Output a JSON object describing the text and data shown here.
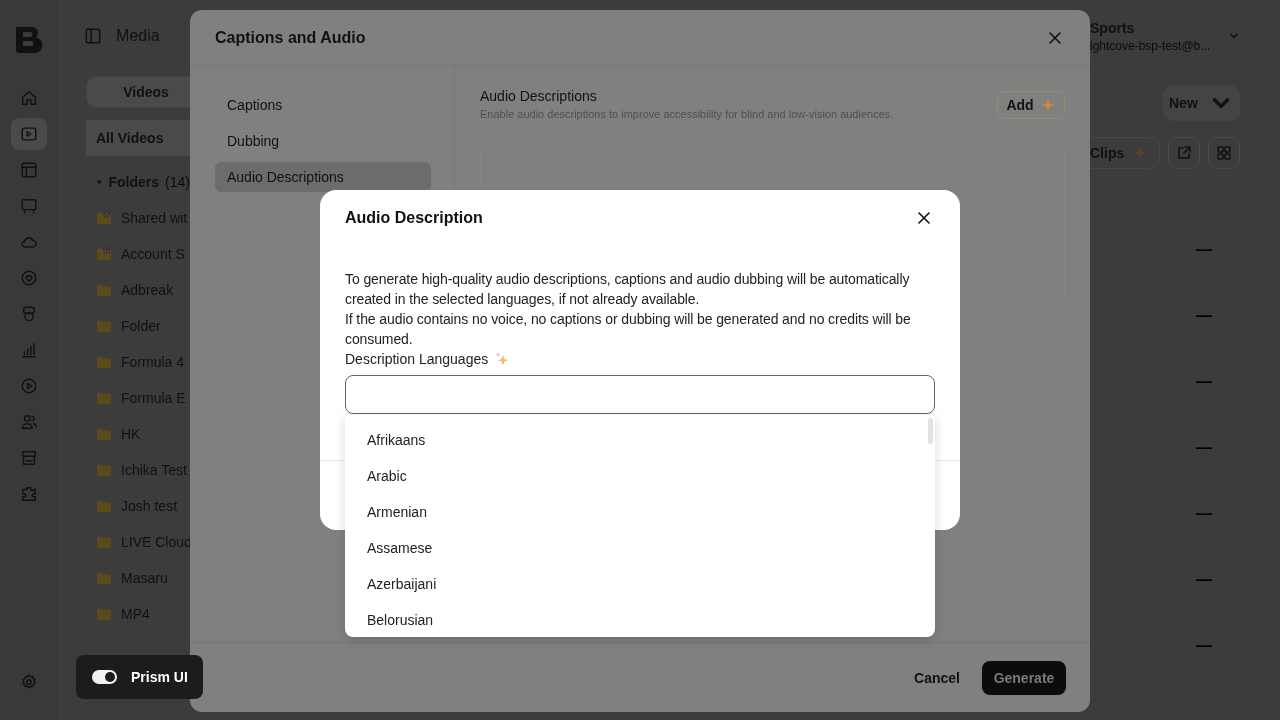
{
  "app": {
    "rail": [
      {
        "selected": false
      },
      {
        "selected": true
      },
      {
        "selected": false
      },
      {
        "selected": false
      },
      {
        "selected": false
      },
      {
        "selected": false
      },
      {
        "selected": false
      },
      {
        "selected": false
      },
      {
        "selected": false
      },
      {
        "selected": false
      },
      {
        "selected": false
      },
      {
        "selected": false
      }
    ],
    "header": {
      "title": "Media"
    },
    "tabs": [
      {
        "label": "Videos",
        "selected": true
      }
    ],
    "all_videos": {
      "label": "All Videos",
      "selected": true
    },
    "folders": {
      "label": "Folders",
      "count": "(14)",
      "expanded": true,
      "items": [
        {
          "name": "Shared wit",
          "kind": "shared"
        },
        {
          "name": "Account S",
          "kind": "account"
        },
        {
          "name": "Adbreak",
          "kind": "folder"
        },
        {
          "name": "Folder",
          "kind": "folder"
        },
        {
          "name": "Formula 4",
          "kind": "folder"
        },
        {
          "name": "Formula E",
          "kind": "folder"
        },
        {
          "name": "HK",
          "kind": "folder"
        },
        {
          "name": "Ichika Test",
          "kind": "folder"
        },
        {
          "name": "Josh test",
          "kind": "folder"
        },
        {
          "name": "LIVE Cloud",
          "kind": "folder"
        },
        {
          "name": "Masaru",
          "kind": "folder"
        },
        {
          "name": "MP4",
          "kind": "folder"
        }
      ]
    },
    "account": {
      "name": "Sports",
      "email": "ightcove-bsp-test@b..."
    },
    "new_button": "New",
    "clips_button": "Clips",
    "rows": [
      {
        "value": "—"
      },
      {
        "value": "—"
      },
      {
        "value": "—"
      },
      {
        "value": "—"
      },
      {
        "value": "—"
      },
      {
        "value": "—"
      },
      {
        "value": "—"
      }
    ],
    "prism": {
      "label": "Prism UI",
      "on": true
    }
  },
  "captions_dialog": {
    "title": "Captions and Audio",
    "nav": [
      {
        "label": "Captions",
        "selected": false
      },
      {
        "label": "Dubbing",
        "selected": false
      },
      {
        "label": "Audio Descriptions",
        "selected": true
      }
    ],
    "section": {
      "title": "Audio Descriptions",
      "subtitle": "Enable audio descriptions to improve accessibility for blind and low-vision audiences.",
      "add_button": "Add"
    },
    "footer": {
      "cancel": "Cancel",
      "generate": "Generate"
    }
  },
  "audio_dialog": {
    "title": "Audio Description",
    "paragraphs": [
      "To generate high-quality audio descriptions, captions and audio dubbing will be automatically created in the selected languages, if not already available.",
      "If the audio contains no voice, no captions or dubbing will be generated and no credits will be consumed."
    ],
    "field_label": "Description Languages",
    "options": [
      {
        "label": "Afrikaans"
      },
      {
        "label": "Arabic"
      },
      {
        "label": "Armenian"
      },
      {
        "label": "Assamese"
      },
      {
        "label": "Azerbaijani"
      },
      {
        "label": "Belorusian"
      }
    ]
  }
}
